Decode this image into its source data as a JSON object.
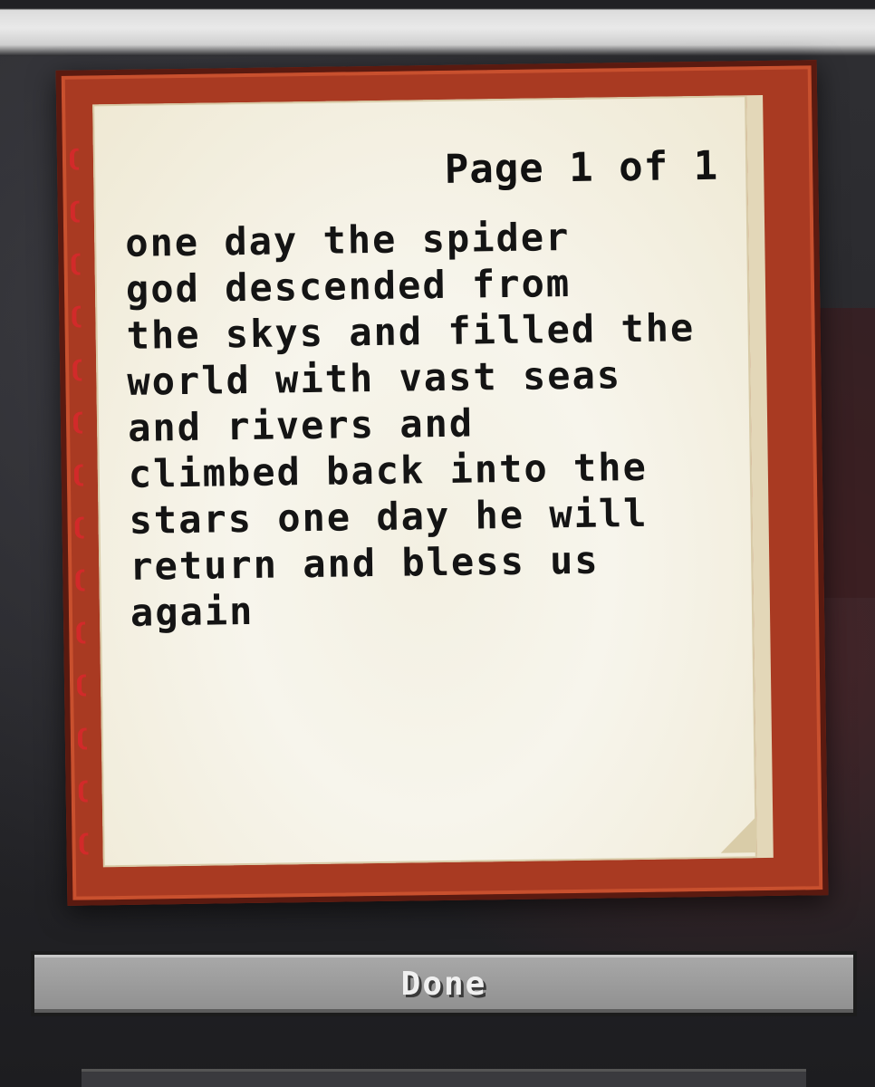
{
  "book": {
    "page_indicator": "Page 1 of 1",
    "content": "one day the spider\ngod descended from\nthe skys and filled the\nworld with vast seas\nand rivers and\nclimbed back into the\nstars one day he will\nreturn and bless us\nagain"
  },
  "actions": {
    "done_label": "Done"
  },
  "colors": {
    "book_cover": "#a93a22",
    "page_paper": "#f7f5ec",
    "binding": "#d22a2a",
    "button_face": "#9a9a9a"
  }
}
